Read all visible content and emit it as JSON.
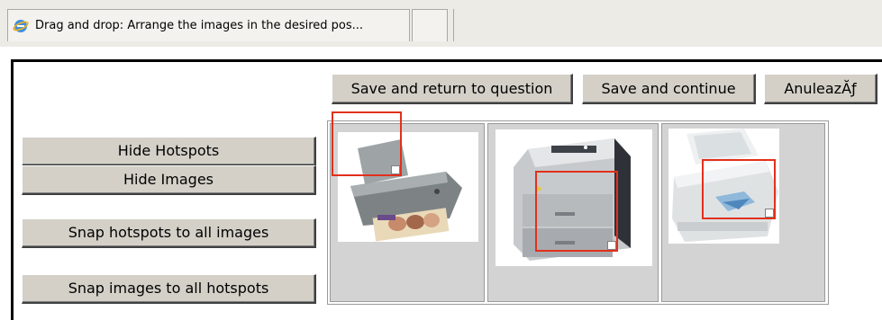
{
  "tab": {
    "title": "Drag and drop: Arrange the images in the desired pos...",
    "icon": "internet-explorer-icon"
  },
  "buttons": {
    "save_return": "Save and return to question",
    "save_continue": "Save and continue",
    "cancel": "AnuleazĂƒ"
  },
  "sidebar": {
    "hide_hotspots": "Hide Hotspots",
    "hide_images": "Hide Images",
    "snap_hotspots": "Snap hotspots to all images",
    "snap_images": "Snap images to all hotspots"
  },
  "images": [
    {
      "subject": "inkjet-printer-with-photo"
    },
    {
      "subject": "laser-printer"
    },
    {
      "subject": "dot-matrix-printer"
    }
  ],
  "colors": {
    "hotspot": "#e2301b",
    "button_face": "#d4d0c8",
    "cell_bg": "#d3d3d3"
  }
}
